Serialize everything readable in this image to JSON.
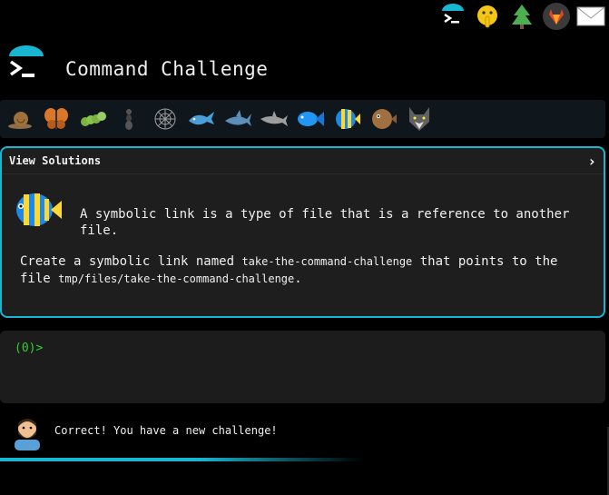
{
  "header": {
    "title": "Command Challenge"
  },
  "levels": {
    "items": [
      {
        "icon": "snail-icon"
      },
      {
        "icon": "butterfly-icon"
      },
      {
        "icon": "caterpillar-icon"
      },
      {
        "icon": "ant-icon"
      },
      {
        "icon": "spider-web-icon"
      },
      {
        "icon": "whale-icon"
      },
      {
        "icon": "shark-icon"
      },
      {
        "icon": "dolphin-icon"
      },
      {
        "icon": "fish-icon"
      },
      {
        "icon": "tropical-fish-icon"
      },
      {
        "icon": "pufferfish-icon"
      },
      {
        "icon": "wolf-icon"
      }
    ]
  },
  "panel": {
    "view_solutions": "View Solutions",
    "chevron": "›",
    "description_1": "A symbolic link is a type of file that is a reference to another file.",
    "task_pre": "Create a symbolic link named ",
    "task_code_1": "take-the-command-challenge",
    "task_mid": " that points to the file ",
    "task_code_2": "tmp/files/take-the-command-challenge",
    "task_post": "."
  },
  "terminal": {
    "prompt": "(0)>"
  },
  "status": {
    "message": "Correct! You have a new challenge!"
  },
  "colors": {
    "accent": "#19b6d1",
    "prompt": "#30d030",
    "background": "#000000"
  }
}
